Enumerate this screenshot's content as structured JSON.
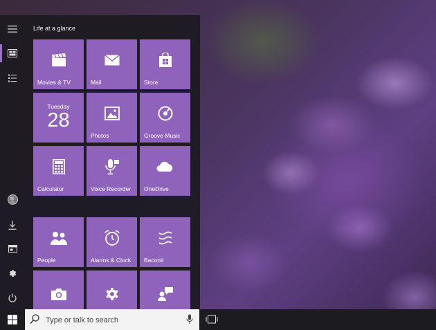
{
  "start_menu": {
    "group_title": "Life at a glance",
    "tiles": [
      {
        "label": "Movies & TV",
        "icon": "clapperboard-icon"
      },
      {
        "label": "Mail",
        "icon": "mail-icon"
      },
      {
        "label": "Store",
        "icon": "store-bag-icon"
      },
      {
        "label": "",
        "icon": "calendar-icon",
        "day": "Tuesday",
        "date": "28"
      },
      {
        "label": "Photos",
        "icon": "photos-icon"
      },
      {
        "label": "Groove Music",
        "icon": "groove-disc-icon"
      },
      {
        "label": "Calculator",
        "icon": "calculator-icon"
      },
      {
        "label": "Voice Recorder",
        "icon": "microphone-icon"
      },
      {
        "label": "OneDrive",
        "icon": "cloud-icon"
      },
      {
        "label": "People",
        "icon": "people-icon"
      },
      {
        "label": "Alarms & Clock",
        "icon": "alarm-clock-icon"
      },
      {
        "label": "Baconit",
        "icon": "waves-icon"
      },
      {
        "label": "",
        "icon": "camera-icon"
      },
      {
        "label": "",
        "icon": "gear-icon"
      },
      {
        "label": "",
        "icon": "feedback-icon"
      }
    ],
    "rail": [
      "hamburger-menu-icon",
      "tiles-view-icon",
      "all-apps-list-icon",
      "user-avatar",
      "downloads-icon",
      "file-explorer-icon",
      "settings-gear-icon",
      "power-icon"
    ]
  },
  "taskbar": {
    "search_placeholder": "Type or talk to search",
    "accent": "#8f63bc"
  }
}
